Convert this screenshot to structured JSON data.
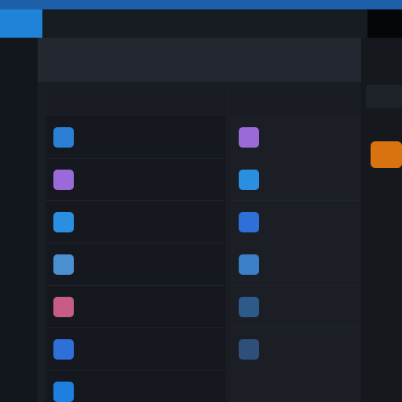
{
  "window": {
    "title": "",
    "accent_color": "#1f84d8"
  },
  "toolbar": {
    "title": ""
  },
  "sidebar": {
    "items": [
      {
        "label": ""
      },
      {
        "label": ""
      },
      {
        "label": ""
      },
      {
        "label": ""
      },
      {
        "label": ""
      },
      {
        "label": ""
      },
      {
        "label": ""
      },
      {
        "label": ""
      }
    ]
  },
  "columns": [
    {
      "header": "",
      "subheader": "",
      "rows": [
        {
          "icon": "folder-icon",
          "color": "#2b7fd4",
          "title": "",
          "subtitle": ""
        },
        {
          "icon": "app-icon",
          "color": "#9a6ad8",
          "title": "",
          "subtitle": ""
        },
        {
          "icon": "cloud-icon",
          "color": "#2a8fe0",
          "title": "",
          "subtitle": ""
        },
        {
          "icon": "file-icon",
          "color": "#4a8fd0",
          "title": "",
          "subtitle": ""
        },
        {
          "icon": "image-icon",
          "color": "#c75c84",
          "title": "",
          "subtitle": ""
        },
        {
          "icon": "drive-icon",
          "color": "#2f6fd8",
          "title": "",
          "subtitle": ""
        },
        {
          "icon": "network-icon",
          "color": "#1f7fe0",
          "title": "",
          "subtitle": ""
        }
      ]
    },
    {
      "header": "",
      "subheader": "",
      "rows": [
        {
          "icon": "app-icon",
          "color": "#9a6ad8",
          "title": "",
          "subtitle": ""
        },
        {
          "icon": "cloud-icon",
          "color": "#2a8fe0",
          "title": "",
          "subtitle": ""
        },
        {
          "icon": "drive-icon",
          "color": "#2f6fd8",
          "title": "",
          "subtitle": ""
        },
        {
          "icon": "network-icon",
          "color": "#3a7fc8",
          "title": "",
          "subtitle": ""
        },
        {
          "icon": "file-icon",
          "color": "#2e5a8a",
          "title": "",
          "subtitle": ""
        },
        {
          "icon": "folder-icon",
          "color": "#2e4f7a",
          "title": "",
          "subtitle": ""
        }
      ]
    }
  ],
  "right_panel": {
    "accent_color": "#d8730f",
    "items": [
      {
        "label": ""
      },
      {
        "label": ""
      },
      {
        "label": ""
      },
      {
        "label": ""
      },
      {
        "label": ""
      }
    ]
  }
}
